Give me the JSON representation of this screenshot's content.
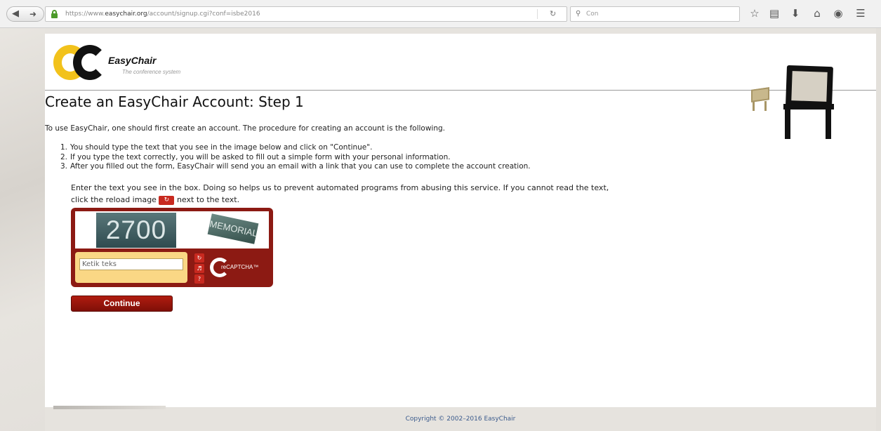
{
  "browser": {
    "url_prefix": "https://www.",
    "url_domain": "easychair.org",
    "url_path": "/account/signup.cgi?conf=isbe2016",
    "search_text": "Con",
    "icons": [
      "back-icon",
      "forward-icon",
      "lock-icon",
      "reload-icon",
      "search-icon",
      "bookmark-star-icon",
      "reading-list-icon",
      "download-icon",
      "home-icon",
      "pocket-icon",
      "menu-icon"
    ]
  },
  "logo": {
    "name": "EasyChair",
    "tagline": "The conference system"
  },
  "page": {
    "title": "Create an EasyChair Account: Step 1",
    "intro": "To use EasyChair, one should first create an account. The procedure for creating an account is the following.",
    "steps": [
      {
        "num": "1.",
        "text": "You should type the text that you see in the image below and click on \"Continue\"."
      },
      {
        "num": "2.",
        "text": "If you type the text correctly, you will be asked to fill out a simple form with your personal information."
      },
      {
        "num": "3.",
        "text": "After you filled out the form, EasyChair will send you an email with a link that you can use to complete the account creation."
      }
    ],
    "captcha_help_1": "Enter the text you see in the box. Doing so helps us to prevent automated programs from abusing this service. If you cannot read the text, click the reload image",
    "captcha_help_2": "next to the text."
  },
  "recaptcha": {
    "word1": "2700",
    "word2": "MEMORIAL",
    "input_placeholder": "Ketik teks",
    "logo_text": "reCAPTCHA™"
  },
  "actions": {
    "continue_label": "Continue"
  },
  "footer": {
    "copyright": "Copyright © 2002–2016 EasyChair"
  },
  "colors": {
    "accent_red": "#8c1a13",
    "button_red": "#b01c10",
    "logo_yellow": "#f2c21b"
  }
}
